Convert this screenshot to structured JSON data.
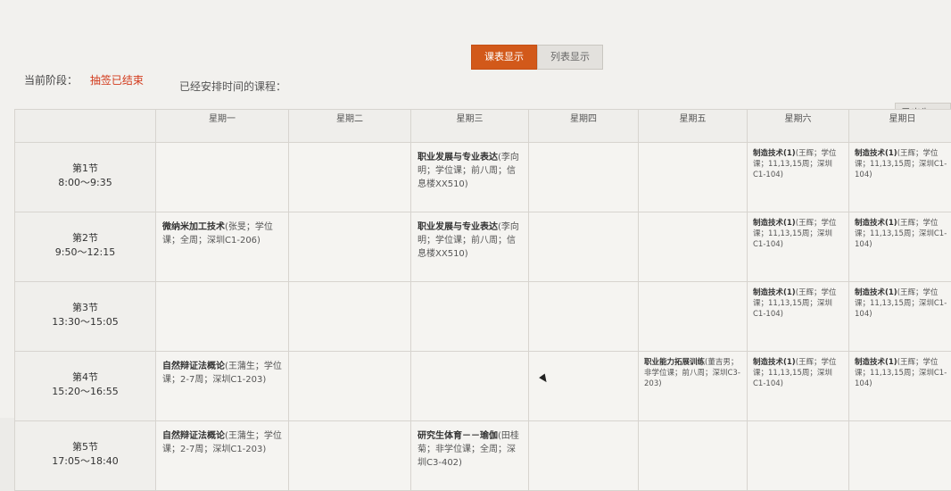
{
  "tabs": {
    "schedule": "课表显示",
    "list": "列表显示"
  },
  "stage": {
    "label": "当前阶段：",
    "value": "抽签已结束"
  },
  "arranged_label": "已经安排时间的课程：",
  "export_label": "导出为XLS",
  "weekdays": [
    "星期一",
    "星期二",
    "星期三",
    "星期四",
    "星期五",
    "星期六",
    "星期日"
  ],
  "periods": [
    {
      "name": "第1节",
      "time": "8:00～9:35"
    },
    {
      "name": "第2节",
      "time": "9:50～12:15"
    },
    {
      "name": "第3节",
      "time": "13:30～15:05"
    },
    {
      "name": "第4节",
      "time": "15:20～16:55"
    },
    {
      "name": "第5节",
      "time": "17:05～18:40"
    }
  ],
  "courses": {
    "p1_wed": {
      "name": "职业发展与专业表达",
      "detail": "(李向明；学位课；前八周；信息楼XX510)"
    },
    "p1_sat": {
      "name": "制造技术(1)",
      "detail": "(王辉；学位课；11,13,15周；深圳C1-104)"
    },
    "p1_sun": {
      "name": "制造技术(1)",
      "detail": "(王辉；学位课；11,13,15周；深圳C1-104)"
    },
    "p2_mon": {
      "name": "微纳米加工技术",
      "detail": "(张旻；学位课；全周；深圳C1-206)"
    },
    "p2_wed": {
      "name": "职业发展与专业表达",
      "detail": "(李向明；学位课；前八周；信息楼XX510)"
    },
    "p2_sat": {
      "name": "制造技术(1)",
      "detail": "(王辉；学位课；11,13,15周；深圳C1-104)"
    },
    "p2_sun": {
      "name": "制造技术(1)",
      "detail": "(王辉；学位课；11,13,15周；深圳C1-104)"
    },
    "p3_sat": {
      "name": "制造技术(1)",
      "detail": "(王辉；学位课；11,13,15周；深圳C1-104)"
    },
    "p3_sun": {
      "name": "制造技术(1)",
      "detail": "(王辉；学位课；11,13,15周；深圳C1-104)"
    },
    "p4_mon": {
      "name": "自然辩证法概论",
      "detail": "(王蒲生；学位课；2-7周；深圳C1-203)"
    },
    "p4_fri": {
      "name": "职业能力拓展训练",
      "detail": "(董吉男；非学位课；前八周；深圳C3-203)"
    },
    "p4_sat": {
      "name": "制造技术(1)",
      "detail": "(王辉；学位课；11,13,15周；深圳C1-104)"
    },
    "p4_sun": {
      "name": "制造技术(1)",
      "detail": "(王辉；学位课；11,13,15周；深圳C1-104)"
    },
    "p5_mon": {
      "name": "自然辩证法概论",
      "detail": "(王蒲生；学位课；2-7周；深圳C1-203)"
    },
    "p5_wed": {
      "name": "研究生体育－－瑜伽",
      "detail": "(田桂菊；非学位课；全周；深圳C3-402)"
    }
  }
}
